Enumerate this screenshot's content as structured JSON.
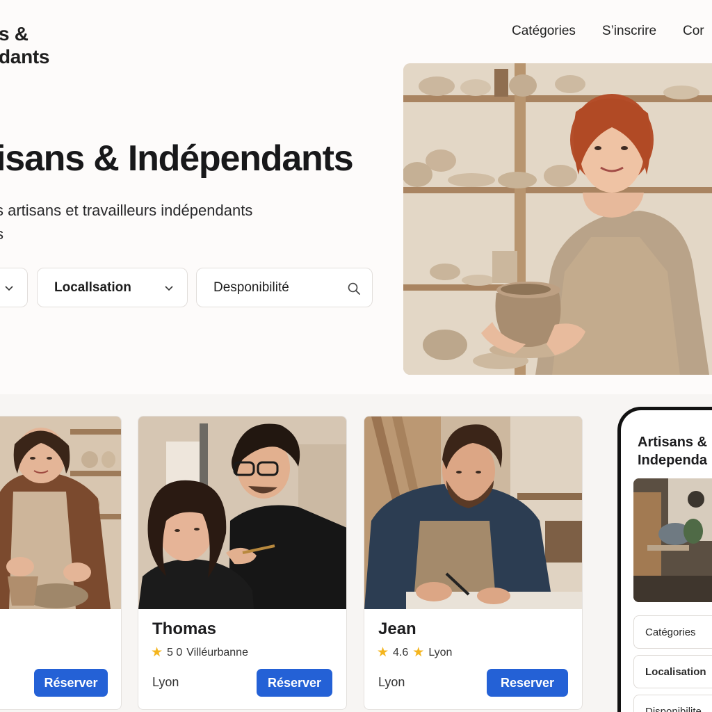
{
  "brand": {
    "line1": "s &",
    "line2": "dants"
  },
  "nav": [
    "Catégories",
    "S’inscrire",
    "Cor"
  ],
  "hero": {
    "title": "isans & Indépendants",
    "subtitle_line1": "s artisans et travailleurs indépendants",
    "subtitle_line2": "s"
  },
  "filters": {
    "location": "Locallsation",
    "availability": "Desponibilité"
  },
  "cards": [
    {
      "button": "Réserver"
    },
    {
      "name": "Thomas",
      "rating": "5 0",
      "place": "Villéurbanne",
      "city": "Lyon",
      "button": "Réserver"
    },
    {
      "name": "Jean",
      "rating": "4.6",
      "place": "Lyon",
      "city": "Lyon",
      "button": "Reserver"
    }
  ],
  "phone": {
    "title_line1": "Artisans &",
    "title_line2": "Independa",
    "fields": [
      "Catégories",
      "Localisation",
      "Disponibilite"
    ]
  },
  "colors": {
    "accent": "#2461d6",
    "star": "#f4b51e",
    "background": "#fdfbfa"
  }
}
